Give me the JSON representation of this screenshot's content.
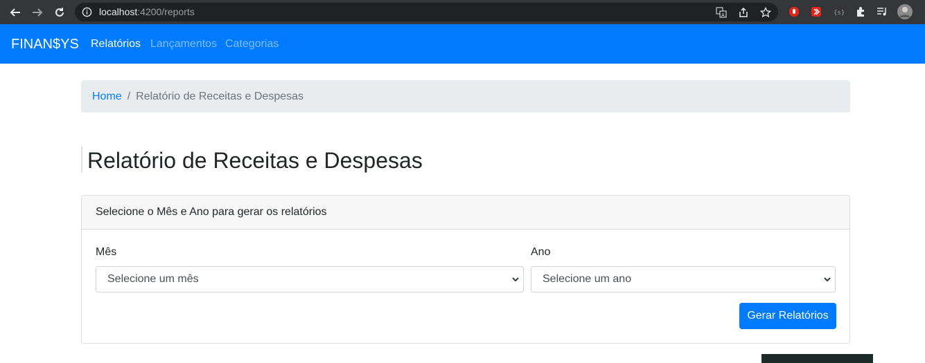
{
  "browser": {
    "url_host": "localhost",
    "url_rest": ":4200/reports"
  },
  "navbar": {
    "brand": "FINAN$YS",
    "links": [
      "Relatórios",
      "Lançamentos",
      "Categorias"
    ]
  },
  "breadcrumb": {
    "home": "Home",
    "separator": "/",
    "current": "Relatório de Receitas e Despesas"
  },
  "page": {
    "title": "Relatório de Receitas e Despesas"
  },
  "card": {
    "header": "Selecione o Mês e Ano para gerar os relatórios",
    "month_label": "Mês",
    "month_value": "Selecione um mês",
    "year_label": "Ano",
    "year_value": "Selecione um ano",
    "submit": "Gerar Relatórios"
  },
  "colors": {
    "primary": "#007bff",
    "breadcrumb_bg": "#e9ecef",
    "chrome_bg": "#35363a"
  }
}
